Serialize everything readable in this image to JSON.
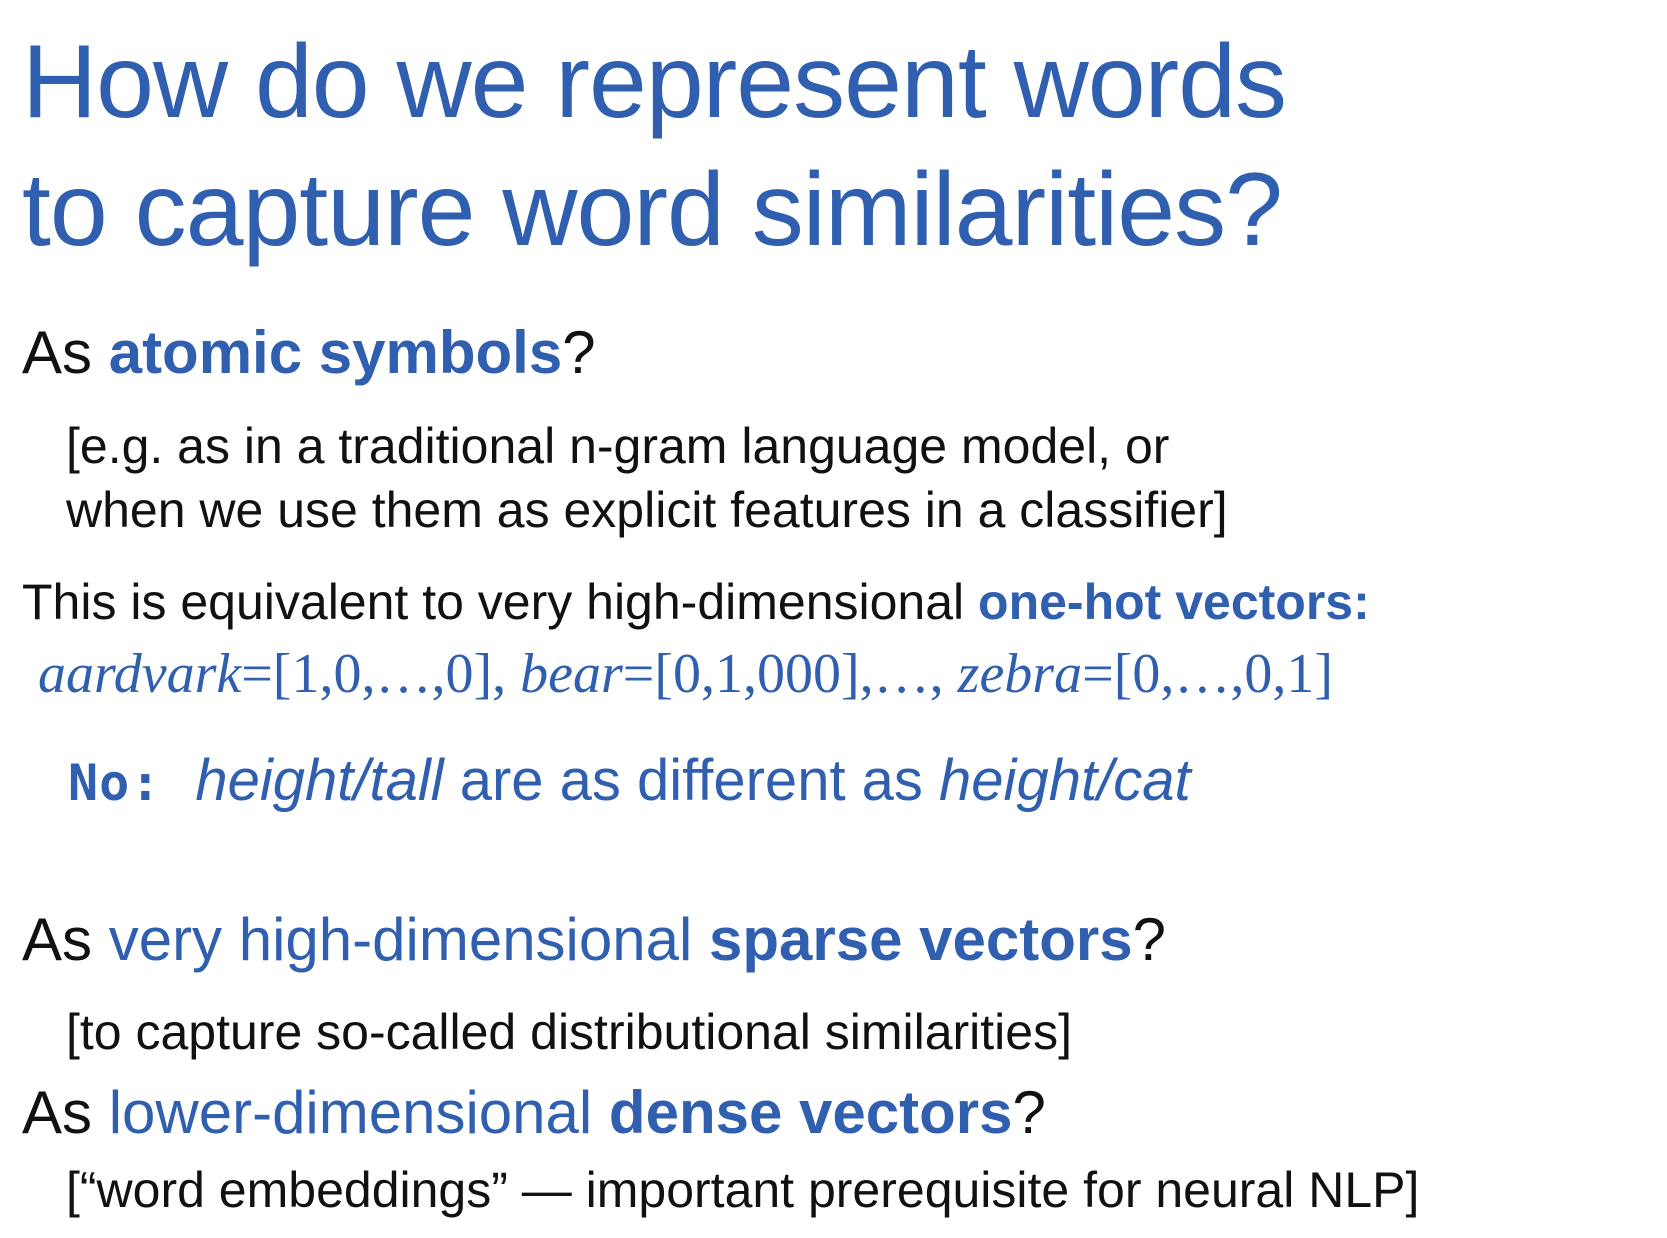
{
  "title": {
    "line1": "How do we represent words",
    "line2": "to capture word similarities?"
  },
  "section1": {
    "prefix": "As ",
    "emph": "atomic symbols",
    "suffix": "?",
    "note_line1": "[e.g. as in a traditional n-gram language model, or",
    "note_line2": "when we use them as explicit features in a classifier]",
    "equiv_text": "This is equivalent to very high-dimensional ",
    "equiv_emph": "one-hot vectors:",
    "vectors": {
      "word1": "aardvark",
      "val1": "=[1,0,…,0], ",
      "word2": "bear",
      "val2": "=[0,1,000],…, ",
      "word3": "zebra",
      "val3": "=[0,…,0,1]"
    },
    "no_line": {
      "label": "No:",
      "pair1": "height/tall",
      "middle": " are as different as ",
      "pair2": "height/cat"
    }
  },
  "section2": {
    "prefix": "As ",
    "light": "very high-dimensional ",
    "emph": "sparse vectors",
    "suffix": "?",
    "note": "[to capture so-called distributional similarities]"
  },
  "section3": {
    "prefix": "As ",
    "light": "lower-dimensional ",
    "emph": "dense vectors",
    "suffix": "?",
    "note": "[“word embeddings” —  important prerequisite for neural NLP]"
  }
}
